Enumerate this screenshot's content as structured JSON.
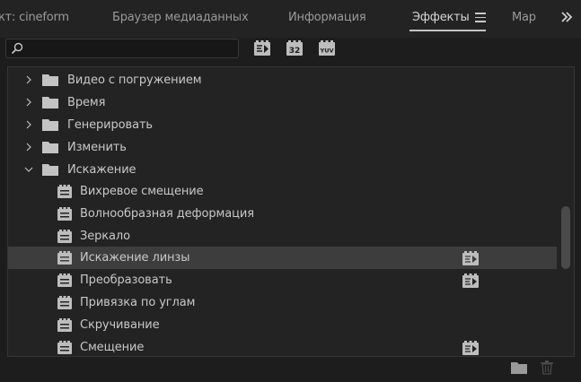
{
  "tabs": [
    {
      "label": "кт: cineform"
    },
    {
      "label": "Браузер медиаданных"
    },
    {
      "label": "Информация"
    },
    {
      "label": "Эффекты"
    },
    {
      "label": "Мар"
    }
  ],
  "active_tab": "Эффекты",
  "search": {
    "value": "",
    "placeholder": ""
  },
  "toolbar": {
    "accelerated_icon": "accelerated-effects-icon",
    "bit32_label": "32",
    "yuv_label": "YUV"
  },
  "tree": {
    "folders": [
      {
        "label": "Видео с погружением",
        "expanded": false
      },
      {
        "label": "Время",
        "expanded": false
      },
      {
        "label": "Генерировать",
        "expanded": false
      },
      {
        "label": "Изменить",
        "expanded": false
      },
      {
        "label": "Искажение",
        "expanded": true
      }
    ],
    "effects": [
      {
        "label": "Вихревое смещение",
        "accelerated": false
      },
      {
        "label": "Волнообразная деформация",
        "accelerated": false
      },
      {
        "label": "Зеркало",
        "accelerated": false
      },
      {
        "label": "Искажение линзы",
        "accelerated": true,
        "selected": true
      },
      {
        "label": "Преобразовать",
        "accelerated": true
      },
      {
        "label": "Привязка по углам",
        "accelerated": false
      },
      {
        "label": "Скручивание",
        "accelerated": false
      },
      {
        "label": "Смещение",
        "accelerated": true
      }
    ]
  },
  "colors": {
    "background": "#1d1d1d",
    "panel": "#232323",
    "selected_row": "#3d3d3d",
    "text": "#c8c8c8"
  }
}
